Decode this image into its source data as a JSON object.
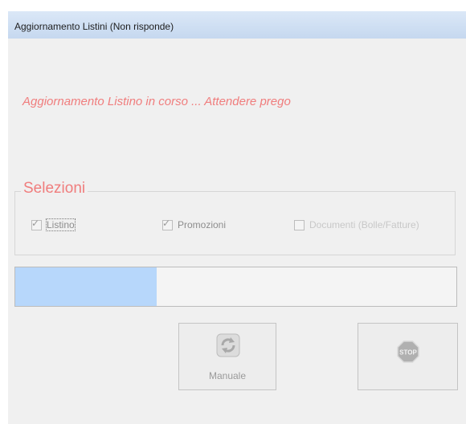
{
  "window": {
    "title": "Aggiornamento Listini (Non risponde)"
  },
  "status_message": "Aggiornamento Listino in corso ... Attendere prego",
  "selections": {
    "legend": "Selezioni",
    "options": [
      {
        "label": "Listino",
        "checked": true,
        "enabled": true
      },
      {
        "label": "Promozioni",
        "checked": true,
        "enabled": true
      },
      {
        "label": "Documenti (Bolle/Fatture)",
        "checked": false,
        "enabled": false
      }
    ]
  },
  "progress": {
    "fraction": 0.32
  },
  "buttons": {
    "manuale": {
      "label": "Manuale",
      "icon": "refresh-icon"
    },
    "stop": {
      "label": "STOP",
      "icon": "stop-icon"
    }
  },
  "colors": {
    "accent_text": "#f07d7d",
    "progress_fill": "#b7d7fb",
    "title_bar": "#cfdff3"
  }
}
